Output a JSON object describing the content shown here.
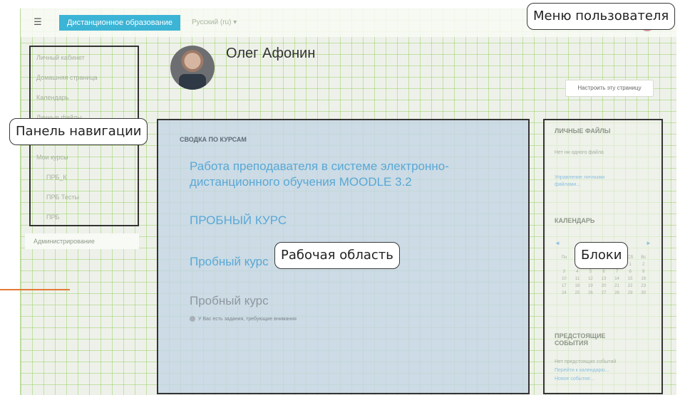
{
  "topbar": {
    "menu_icon": "hamburger-icon",
    "site_name": "Дистанционное образование",
    "language": "Русский (ru) ▾"
  },
  "nav_drawer": {
    "items": [
      "Личный кабинет",
      "Домашняя страница",
      "Календарь",
      "Личные файлы",
      "Мои курсы",
      "ПРБ_К",
      "ПРБ Тесты",
      "ПРБ"
    ],
    "admin_label": "Администрирование"
  },
  "profile": {
    "name": "Олег Афонин",
    "customize_label": "Настроить эту страницу"
  },
  "main": {
    "summary_heading": "СВОДКА ПО КУРСАМ",
    "courses": [
      "Работа преподавателя в системе электронно-дистанционного обучения MOODLE 3.2",
      "ПРОБНЫЙ КУРС",
      "Пробный курс",
      "Пробный курс"
    ],
    "notice": "У Вас есть задания, требующие внимания"
  },
  "blocks": {
    "private_files_title": "ЛИЧНЫЕ ФАЙЛЫ",
    "private_files_empty": "Нет ни одного файла",
    "private_files_manage": "Управление личными файлами...",
    "calendar_title": "КАЛЕНДАРЬ",
    "calendar_prev": "◄",
    "calendar_next": "►",
    "calendar_days": [
      "Пн",
      "Вт",
      "Ср",
      "Чт",
      "Пт",
      "Сб",
      "Вс"
    ],
    "calendar_dates": [
      "",
      "",
      "",
      "",
      "",
      "1",
      "2",
      "3",
      "4",
      "5",
      "6",
      "7",
      "8",
      "9",
      "10",
      "11",
      "12",
      "13",
      "14",
      "15",
      "16",
      "17",
      "18",
      "19",
      "20",
      "21",
      "22",
      "23",
      "24",
      "25",
      "26",
      "27",
      "28",
      "29",
      "30"
    ],
    "upcoming_title": "ПРЕДСТОЯЩИЕ СОБЫТИЯ",
    "upcoming_empty": "Нет предстоящих событий",
    "upcoming_calendar_link": "Перейти к календарю...",
    "upcoming_new_event": "Новое событие..."
  },
  "callouts": {
    "user_menu": "Меню пользователя",
    "nav_panel": "Панель навигации",
    "work_area": "Рабочая область",
    "blocks": "Блоки"
  },
  "colors": {
    "accent": "#3bb4d6",
    "link": "#5aa8d6",
    "grid": "#8ccd50",
    "annotation_line": "#e27a35"
  }
}
